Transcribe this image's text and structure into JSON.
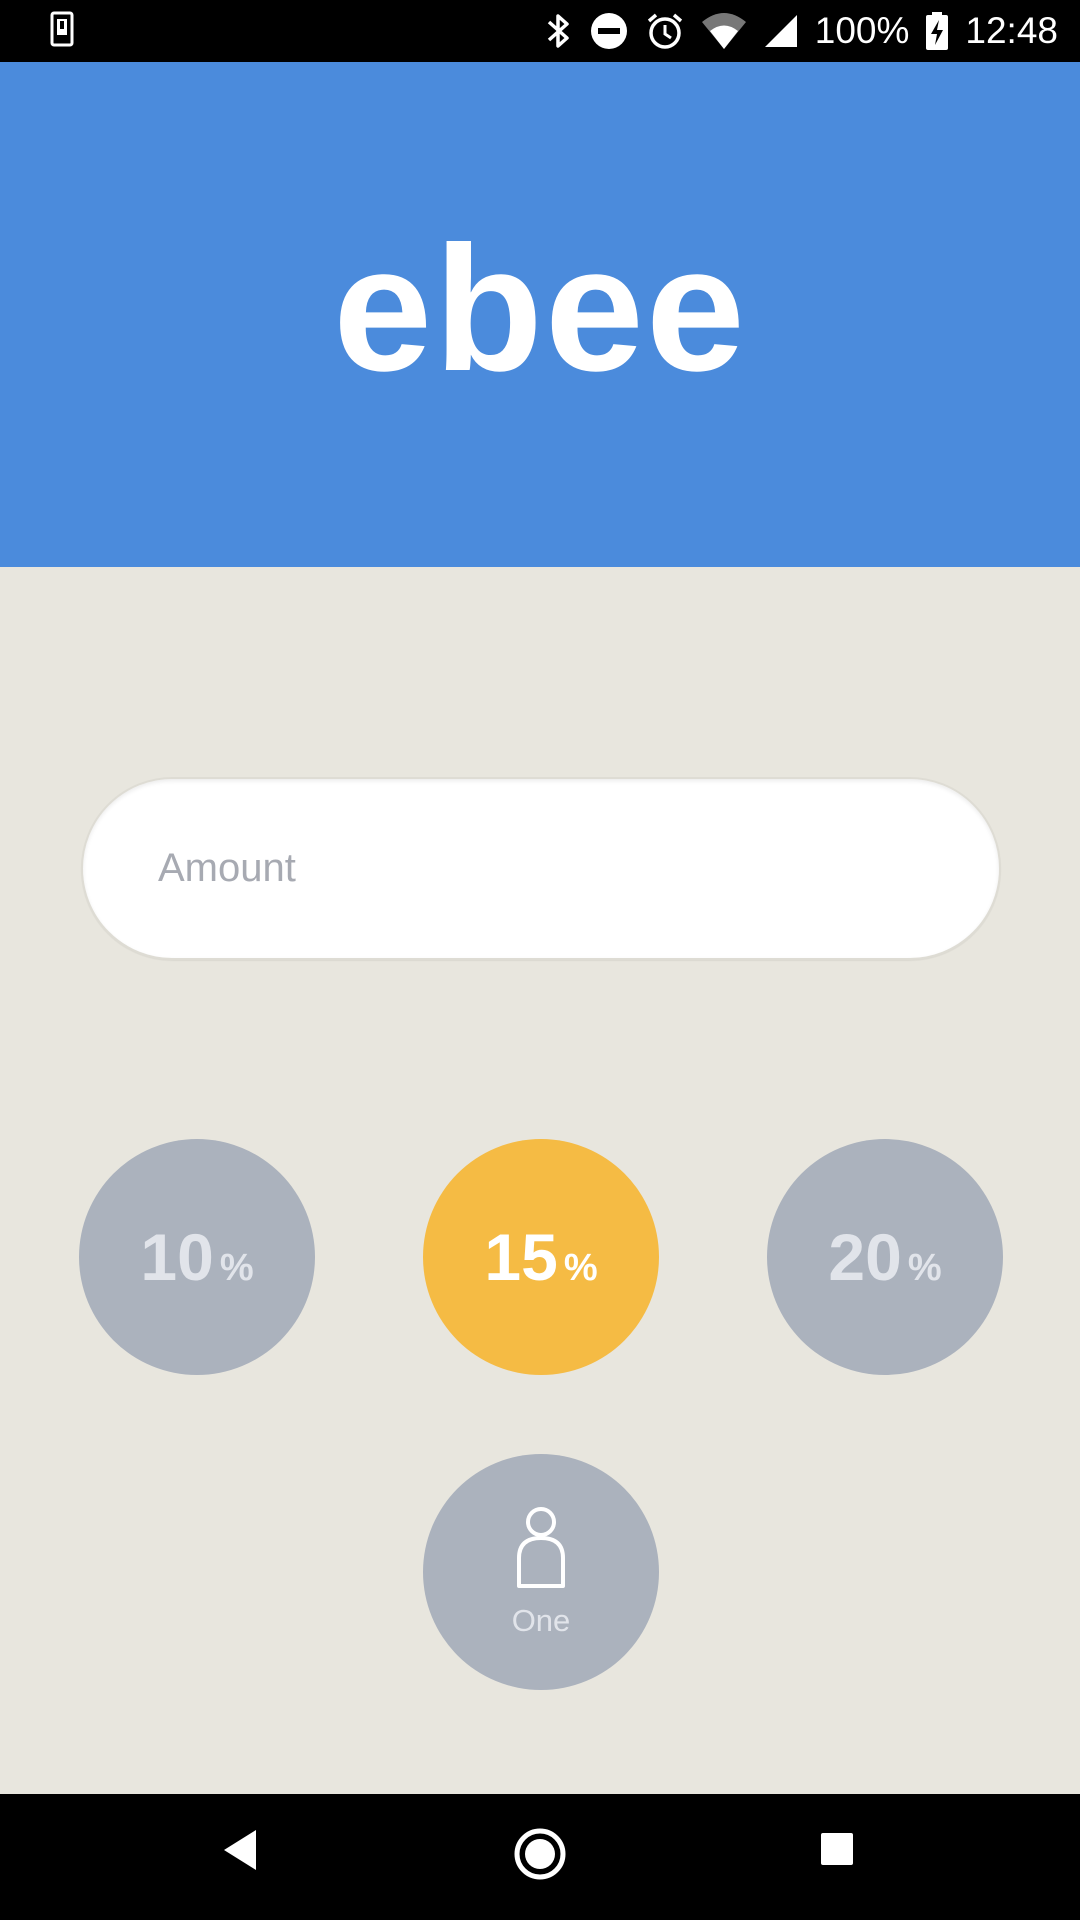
{
  "status_bar": {
    "battery_percent": "100%",
    "time": "12:48",
    "icons": [
      "screenshot-icon",
      "bluetooth-icon",
      "do-not-disturb-icon",
      "alarm-icon",
      "wifi-icon",
      "signal-icon",
      "battery-charging-icon"
    ]
  },
  "header": {
    "title": "ebee",
    "background_color": "#4b8bdc"
  },
  "amount": {
    "value": "",
    "placeholder": "Amount"
  },
  "tip_options": [
    {
      "value": "10",
      "unit": "%",
      "selected": false
    },
    {
      "value": "15",
      "unit": "%",
      "selected": true
    },
    {
      "value": "20",
      "unit": "%",
      "selected": false
    }
  ],
  "split": {
    "label": "One",
    "icon": "person-icon"
  },
  "colors": {
    "selected": "#f5bb44",
    "unselected": "#abb2bd",
    "background": "#e8e6de"
  },
  "nav_bar": {
    "icons": [
      "back-icon",
      "home-icon",
      "recents-icon"
    ]
  }
}
